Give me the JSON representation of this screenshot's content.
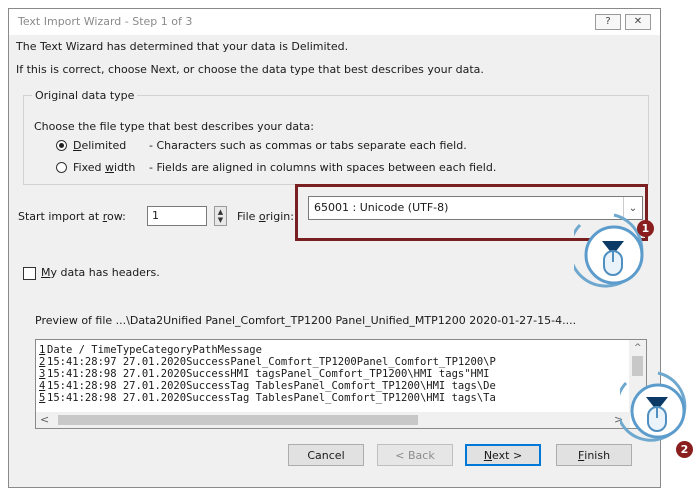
{
  "title": "Text Import Wizard - Step 1 of 3",
  "title_buttons": {
    "help": "?",
    "close": "✕"
  },
  "intro": {
    "line1": "The Text Wizard has determined that your data is Delimited.",
    "line2": "If this is correct, choose Next, or choose the data type that best describes your data."
  },
  "group": {
    "legend": "Original data type",
    "prompt": "Choose the file type that best describes your data:",
    "options": [
      {
        "prefix": "",
        "hotkey": "D",
        "suffix": "elimited",
        "desc": "- Characters such as commas or tabs separate each field.",
        "selected": true
      },
      {
        "prefix": "Fixed ",
        "hotkey": "w",
        "suffix": "idth",
        "desc": "- Fields are aligned in columns with spaces between each field.",
        "selected": false
      }
    ]
  },
  "start_import": {
    "label_prefix": "Start import at ",
    "hotkey": "r",
    "label_suffix": "ow:",
    "value": "1"
  },
  "file_origin": {
    "label_prefix": "File ",
    "hotkey": "o",
    "label_suffix": "rigin:",
    "value": "65001 : Unicode (UTF-8)"
  },
  "headers_checkbox": {
    "hotkey": "M",
    "label_suffix": "y data has headers.",
    "checked": false
  },
  "preview": {
    "caption": "Preview of file ...\\Data2Unified Panel_Comfort_TP1200 Panel_Unified_MTP1200 2020-01-27-15-4....",
    "rows": [
      {
        "num": "1",
        "text": "Date / TimeTypeCategoryPathMessage"
      },
      {
        "num": "2",
        "text": "15:41:28:97 27.01.2020SuccessPanel_Comfort_TP1200Panel_Comfort_TP1200\\P"
      },
      {
        "num": "3",
        "text": "15:41:28:98 27.01.2020SuccessHMI tagsPanel_Comfort_TP1200\\HMI tags\"HMI"
      },
      {
        "num": "4",
        "text": "15:41:28:98 27.01.2020SuccessTag TablesPanel_Comfort_TP1200\\HMI tags\\De"
      },
      {
        "num": "5",
        "text": "15:41:28:98 27.01.2020SuccessTag TablesPanel_Comfort_TP1200\\HMI tags\\Ta"
      }
    ]
  },
  "buttons": {
    "cancel": "Cancel",
    "back": "< Back",
    "next_hotkey": "N",
    "next_suffix": "ext >",
    "finish_hotkey": "F",
    "finish_suffix": "inish"
  },
  "markers": {
    "one": "1",
    "two": "2"
  },
  "colors": {
    "highlight": "#7a1f1f",
    "badge": "#8a1e1e",
    "cursor": "#6ea8cf",
    "default_button": "#0078d7"
  }
}
